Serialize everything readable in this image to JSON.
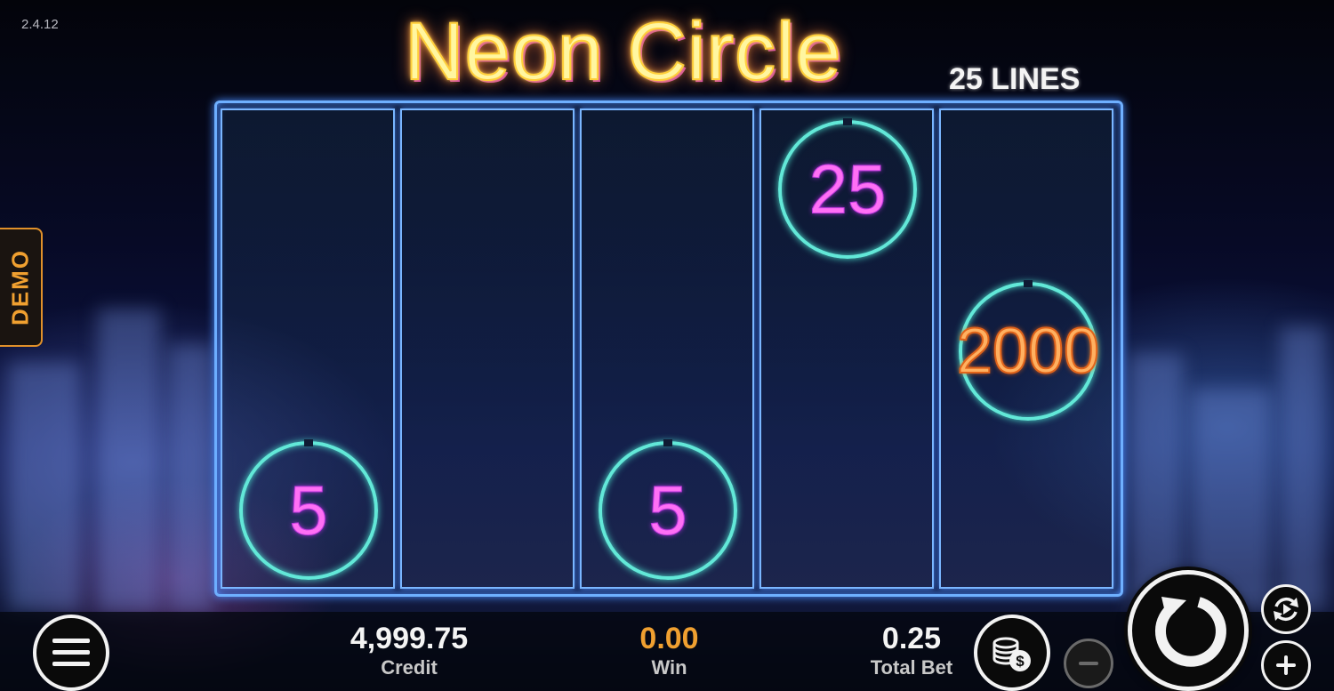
{
  "version": "2.4.12",
  "title": {
    "game_name": "Neon Circle",
    "lines": "25 LINES"
  },
  "demo_label": "DEMO",
  "reels": [
    {
      "symbols": [
        {
          "value": "5",
          "row": "bottom"
        }
      ]
    },
    {
      "symbols": []
    },
    {
      "symbols": [
        {
          "value": "5",
          "row": "bottom"
        }
      ]
    },
    {
      "symbols": [
        {
          "value": "25",
          "row": "top"
        }
      ]
    },
    {
      "symbols": [
        {
          "value": "2000",
          "row": "middle"
        }
      ]
    }
  ],
  "stats": {
    "credit": {
      "value": "4,999.75",
      "label": "Credit"
    },
    "win": {
      "value": "0.00",
      "label": "Win"
    },
    "total_bet": {
      "value": "0.25",
      "label": "Total Bet"
    }
  },
  "icons": {
    "menu": "menu-icon",
    "coins": "coins-dollar-icon",
    "minus": "minus-icon",
    "spin": "spin-arrow-icon",
    "autoplay": "autoplay-icon",
    "plus": "plus-icon"
  },
  "colors": {
    "title_yellow": "#fff6a0",
    "title_glow": "#ffb347",
    "reel_border": "#7ab6ff",
    "circle_teal": "#62e8d8",
    "symbol_magenta": "#ff6ff5",
    "symbol_orange": "#ffb060",
    "win_orange": "#f0a030",
    "demo_orange": "#e0902a"
  }
}
